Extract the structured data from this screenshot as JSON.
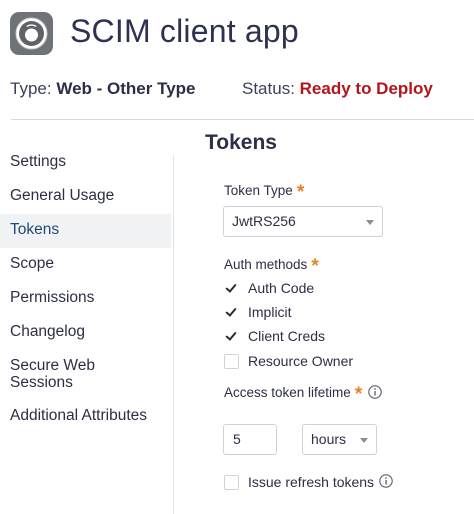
{
  "app": {
    "title": "SCIM client app",
    "logo_icon": "app-logo-icon"
  },
  "meta": {
    "type_label": "Type:",
    "type_value": "Web - Other Type",
    "status_label": "Status:",
    "status_value": "Ready to Deploy",
    "status_color": "#b3151d"
  },
  "sidebar": {
    "items": [
      {
        "label": "Settings",
        "active": false
      },
      {
        "label": "General Usage",
        "active": false
      },
      {
        "label": "Tokens",
        "active": true
      },
      {
        "label": "Scope",
        "active": false
      },
      {
        "label": "Permissions",
        "active": false
      },
      {
        "label": "Changelog",
        "active": false
      },
      {
        "label": "Secure Web Sessions",
        "active": false
      },
      {
        "label": "Additional Attributes",
        "active": false
      }
    ]
  },
  "tokens": {
    "title": "Tokens",
    "token_type": {
      "label": "Token Type",
      "required": "*",
      "value": "JwtRS256"
    },
    "auth_methods": {
      "label": "Auth methods",
      "required": "*",
      "options": [
        {
          "label": "Auth Code",
          "checked": true
        },
        {
          "label": "Implicit",
          "checked": true
        },
        {
          "label": "Client Creds",
          "checked": true
        },
        {
          "label": "Resource Owner",
          "checked": false
        }
      ]
    },
    "access_token_lifetime": {
      "label": "Access token lifetime",
      "required": "*",
      "value": "5",
      "unit": "hours"
    },
    "issue_refresh_tokens": {
      "label": "Issue refresh tokens",
      "checked": false
    }
  },
  "colors": {
    "accent_star": "#e8821f",
    "active_nav_text": "#1d4b7a",
    "active_nav_bg": "#f1f2f4"
  }
}
